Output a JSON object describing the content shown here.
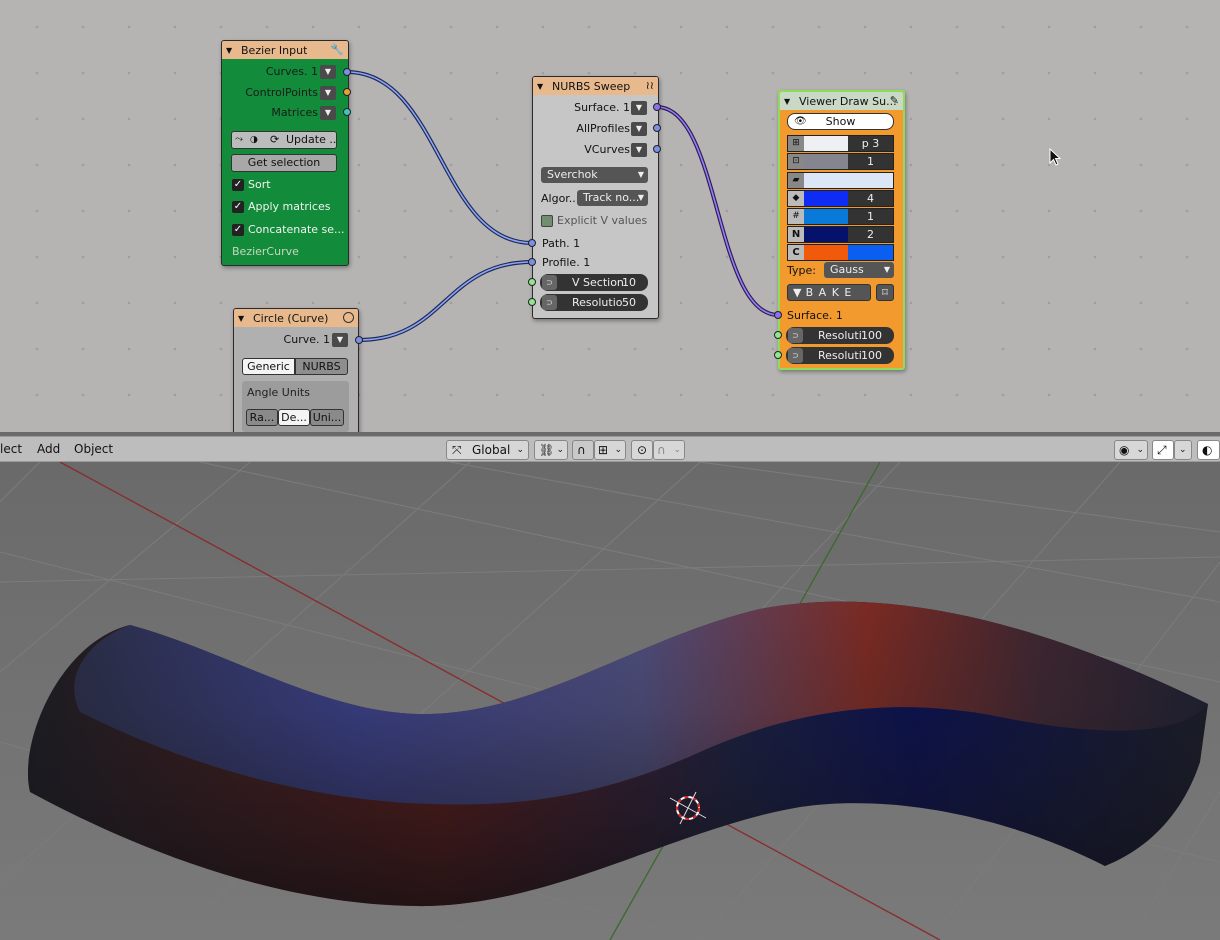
{
  "node_editor": {
    "bezier_input": {
      "title": "Bezier Input",
      "outputs": [
        "Curves. 1",
        "ControlPoints",
        "Matrices"
      ],
      "update_button": "Update ...",
      "get_selection_button": "Get selection",
      "checkboxes": [
        {
          "label": "Sort",
          "checked": true
        },
        {
          "label": "Apply matrices",
          "checked": true
        },
        {
          "label": "Concatenate se...",
          "checked": true
        }
      ],
      "footer": "BezierCurve",
      "color": "#128c3a"
    },
    "circle_curve": {
      "title": "Circle (Curve)",
      "output": "Curve. 1",
      "tabs": [
        "Generic",
        "NURBS"
      ],
      "angle_units_label": "Angle Units",
      "angle_unit_buttons": [
        "Ra...",
        "De...",
        "Uni..."
      ]
    },
    "nurbs_sweep": {
      "title": "NURBS Sweep",
      "outputs": [
        "Surface. 1",
        "AllProfiles",
        "VCurves"
      ],
      "implementation": "Sverchok",
      "algorithm_label": "Algor...",
      "algorithm_value": "Track no...",
      "explicit_v_label": "Explicit V values",
      "inputs": [
        "Path. 1",
        "Profile. 1"
      ],
      "v_section": {
        "label": "V Section",
        "value": "10"
      },
      "resolution": {
        "label": "Resolutio",
        "value": "50"
      }
    },
    "viewer_draw": {
      "title": "Viewer Draw Su...",
      "show_button": "Show",
      "swatches": [
        {
          "color": "#eef0f4",
          "value": "p 3"
        },
        {
          "color": "#85858f",
          "value": "1"
        },
        {
          "color": "#dbe7f6",
          "value": ""
        },
        {
          "color": "#0f2cf5",
          "value": "4"
        },
        {
          "color": "#0a7ad8",
          "value": "1"
        },
        {
          "color": "#06116e",
          "value": "2"
        },
        {
          "color": "#f15a0a",
          "value": "",
          "color2": "#0a5ff0"
        }
      ],
      "type_label": "Type:",
      "type_value": "Gauss",
      "bake_button": "B A K E",
      "input": "Surface. 1",
      "resolutions": [
        {
          "label": "Resoluti",
          "value": "100"
        },
        {
          "label": "Resoluti",
          "value": "100"
        }
      ],
      "color": "#f39a2f"
    }
  },
  "header": {
    "menus": [
      "lect",
      "Add",
      "Object"
    ],
    "orientation": "Global"
  }
}
